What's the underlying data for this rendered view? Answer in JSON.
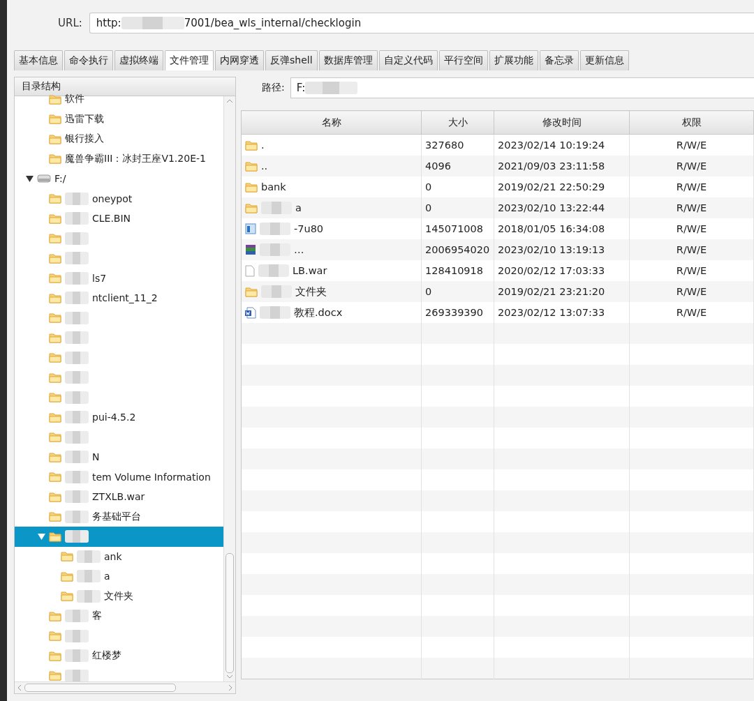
{
  "url_bar": {
    "label": "URL:",
    "value_start": "http:",
    "value_end": "7001/bea_wls_internal/checklogin",
    "redacted": true
  },
  "tabs": [
    {
      "label": "基本信息",
      "selected": false
    },
    {
      "label": "命令执行",
      "selected": false
    },
    {
      "label": "虚拟终端",
      "selected": false
    },
    {
      "label": "文件管理",
      "selected": true
    },
    {
      "label": "内网穿透",
      "selected": false
    },
    {
      "label": "反弹shell",
      "selected": false
    },
    {
      "label": "数据库管理",
      "selected": false
    },
    {
      "label": "自定义代码",
      "selected": false
    },
    {
      "label": "平行空间",
      "selected": false
    },
    {
      "label": "扩展功能",
      "selected": false
    },
    {
      "label": "备忘录",
      "selected": false
    },
    {
      "label": "更新信息",
      "selected": false
    }
  ],
  "tree": {
    "title": "目录结构",
    "items": [
      {
        "kind": "folder",
        "label": "软件",
        "redacted": false,
        "selected": false
      },
      {
        "kind": "folder",
        "label": "迅雷下载",
        "redacted": false,
        "selected": false
      },
      {
        "kind": "folder",
        "label": "银行接入",
        "redacted": false,
        "selected": false
      },
      {
        "kind": "folder",
        "label": "魔兽争霸III：冰封王座V1.20E-1",
        "redacted": false,
        "selected": false
      },
      {
        "kind": "drive",
        "label": "F:/",
        "redacted": false,
        "selected": false,
        "expanded": true,
        "children": [
          {
            "kind": "folder",
            "label": "oneypot",
            "redacted": true,
            "selected": false
          },
          {
            "kind": "folder",
            "label": "CLE.BIN",
            "redacted": true,
            "selected": false
          },
          {
            "kind": "folder",
            "redacted": true,
            "selected": false
          },
          {
            "kind": "folder",
            "redacted": true,
            "selected": false
          },
          {
            "kind": "folder",
            "label": "ls7",
            "redacted": true,
            "selected": false
          },
          {
            "kind": "folder",
            "label": "ntclient_11_2",
            "redacted": true,
            "selected": false
          },
          {
            "kind": "folder",
            "redacted": true,
            "selected": false
          },
          {
            "kind": "folder",
            "redacted": true,
            "selected": false
          },
          {
            "kind": "folder",
            "redacted": true,
            "selected": false
          },
          {
            "kind": "folder",
            "redacted": true,
            "selected": false
          },
          {
            "kind": "folder",
            "redacted": true,
            "selected": false
          },
          {
            "kind": "folder",
            "label": "pui-4.5.2",
            "redacted": true,
            "selected": false
          },
          {
            "kind": "folder",
            "redacted": true,
            "selected": false
          },
          {
            "kind": "folder",
            "label": "N",
            "redacted": true,
            "selected": false
          },
          {
            "kind": "folder",
            "label": "tem Volume Information",
            "redacted": true,
            "selected": false
          },
          {
            "kind": "folder",
            "label": "ZTXLB.war",
            "redacted": true,
            "selected": false
          },
          {
            "kind": "folder",
            "label": "务基础平台",
            "redacted": true,
            "selected": false
          },
          {
            "kind": "folder",
            "redacted": true,
            "selected": true,
            "expanded": true,
            "children": [
              {
                "kind": "folder",
                "label": "ank",
                "redacted": true,
                "selected": false
              },
              {
                "kind": "folder",
                "label": "a",
                "redacted": true,
                "selected": false
              },
              {
                "kind": "folder",
                "label": "文件夹",
                "redacted": true,
                "selected": false
              }
            ]
          },
          {
            "kind": "folder",
            "label": "客",
            "redacted": true,
            "selected": false
          },
          {
            "kind": "folder",
            "redacted": true,
            "selected": false
          },
          {
            "kind": "folder",
            "label": "红楼梦",
            "redacted": true,
            "selected": false
          },
          {
            "kind": "folder",
            "redacted": true,
            "selected": false
          }
        ]
      }
    ]
  },
  "path_bar": {
    "label": "路径:",
    "value": "F:",
    "redacted": true
  },
  "table": {
    "columns": [
      "名称",
      "大小",
      "修改时间",
      "权限"
    ],
    "rows": [
      {
        "kind": "folder",
        "name": ".",
        "redacted": false,
        "size": "327680",
        "modified": "2023/02/14 10:19:24",
        "permissions": "R/W/E"
      },
      {
        "kind": "folder",
        "name": "..",
        "redacted": false,
        "size": "4096",
        "modified": "2021/09/03 23:11:58",
        "permissions": "R/W/E"
      },
      {
        "kind": "folder",
        "name": "bank",
        "redacted": false,
        "size": "0",
        "modified": "2019/02/21 22:50:29",
        "permissions": "R/W/E"
      },
      {
        "kind": "folder",
        "name": "a",
        "redacted": true,
        "size": "0",
        "modified": "2023/02/10 13:22:44",
        "permissions": "R/W/E"
      },
      {
        "kind": "installer",
        "name": "-7u80",
        "redacted": true,
        "size": "145071008",
        "modified": "2018/01/05 16:34:08",
        "permissions": "R/W/E"
      },
      {
        "kind": "archive",
        "name": "…",
        "redacted": true,
        "size": "2006954020",
        "modified": "2023/02/10 13:19:13",
        "permissions": "R/W/E"
      },
      {
        "kind": "file",
        "name": "LB.war",
        "redacted": true,
        "size": "128410918",
        "modified": "2020/02/12 17:03:33",
        "permissions": "R/W/E"
      },
      {
        "kind": "folder",
        "name": "文件夹",
        "redacted": true,
        "size": "0",
        "modified": "2019/02/21 23:21:20",
        "permissions": "R/W/E"
      },
      {
        "kind": "document",
        "name": "教程.docx",
        "redacted": true,
        "size": "269339390",
        "modified": "2023/02/12 13:07:33",
        "permissions": "R/W/E"
      }
    ]
  }
}
